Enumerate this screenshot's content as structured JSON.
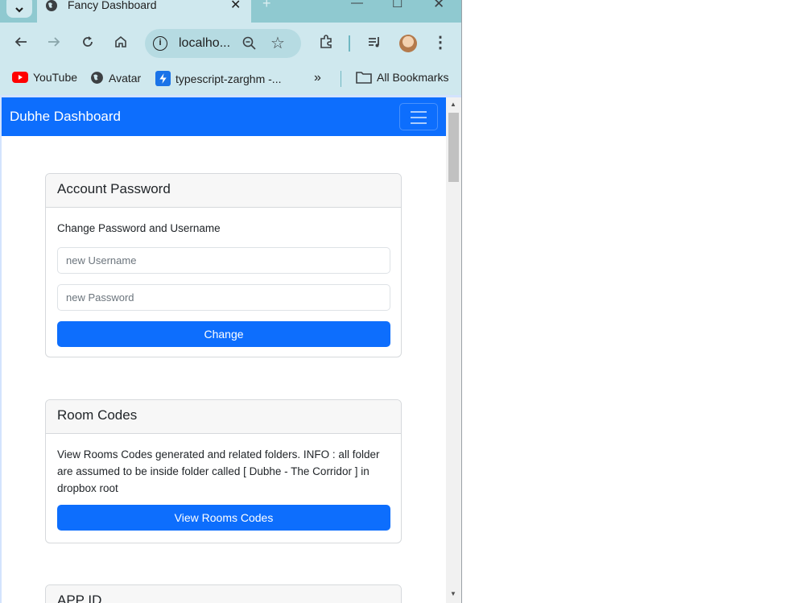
{
  "browser": {
    "tab": {
      "title": "Fancy Dashboard"
    },
    "new_tab_symbol": "+",
    "address": {
      "url": "localho..."
    },
    "bookmarks": [
      {
        "label": "YouTube"
      },
      {
        "label": "Avatar"
      },
      {
        "label": "typescript-zarghm -..."
      }
    ],
    "bookmarks_overflow": "»",
    "all_bookmarks": "All Bookmarks",
    "colors": {
      "frame": "#8fc9d0",
      "toolbar": "#cfe8ee",
      "omnibox": "#b6dbe2"
    }
  },
  "page": {
    "brand": "Dubhe Dashboard",
    "navbar_color": "#0d6efd",
    "cards": {
      "account": {
        "header": "Account Password",
        "text": "Change Password and Username",
        "username_placeholder": "new Username",
        "password_placeholder": "new Password",
        "button": "Change"
      },
      "rooms": {
        "header": "Room Codes",
        "text": "View Rooms Codes generated and related folders. INFO : all folder are assumed to be inside folder called [ Dubhe - The Corridor ] in dropbox root",
        "button": "View Rooms Codes"
      },
      "app": {
        "header": "APP ID"
      }
    }
  }
}
